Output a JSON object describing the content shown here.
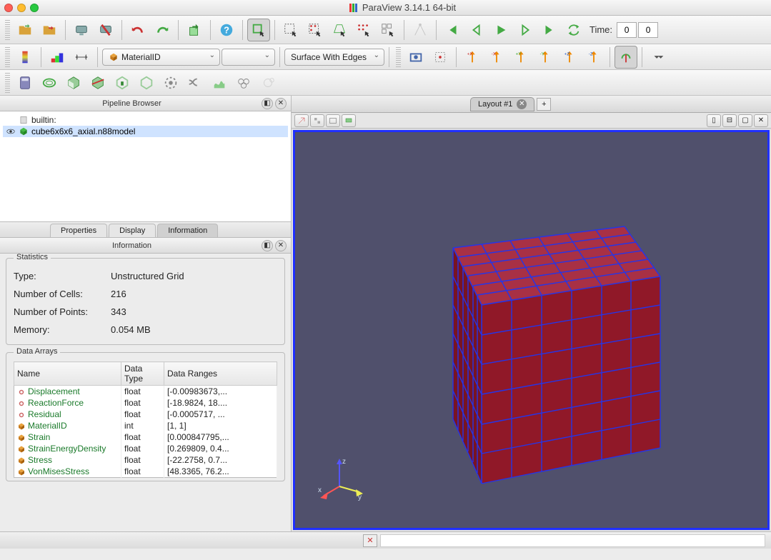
{
  "window": {
    "title": "ParaView 3.14.1 64-bit"
  },
  "toolbar1": {
    "time_label": "Time:",
    "time_val1": "0",
    "time_val2": "0"
  },
  "toolbar2": {
    "combo_color": "MaterialID",
    "combo_mid": "",
    "combo_repr": "Surface With Edges"
  },
  "pipeline": {
    "title": "Pipeline Browser",
    "root": "builtin:",
    "item": "cube6x6x6_axial.n88model"
  },
  "tabs": {
    "props": "Properties",
    "display": "Display",
    "info": "Information"
  },
  "info_panel": {
    "title": "Information"
  },
  "stats": {
    "group": "Statistics",
    "type_k": "Type:",
    "type_v": "Unstructured Grid",
    "cells_k": "Number of Cells:",
    "cells_v": "216",
    "points_k": "Number of Points:",
    "points_v": "343",
    "mem_k": "Memory:",
    "mem_v": "0.054 MB"
  },
  "darrays": {
    "group": "Data Arrays",
    "h_name": "Name",
    "h_type": "Data Type",
    "h_range": "Data Ranges",
    "rows": [
      {
        "kind": "pt",
        "name": "Displacement",
        "type": "float",
        "range": "[-0.00983673,..."
      },
      {
        "kind": "pt",
        "name": "ReactionForce",
        "type": "float",
        "range": "[-18.9824, 18...."
      },
      {
        "kind": "pt",
        "name": "Residual",
        "type": "float",
        "range": "[-0.0005717, ..."
      },
      {
        "kind": "cell",
        "name": "MaterialID",
        "type": "int",
        "range": "[1, 1]"
      },
      {
        "kind": "cell",
        "name": "Strain",
        "type": "float",
        "range": "[0.000847795,..."
      },
      {
        "kind": "cell",
        "name": "StrainEnergyDensity",
        "type": "float",
        "range": "[0.269809, 0.4..."
      },
      {
        "kind": "cell",
        "name": "Stress",
        "type": "float",
        "range": "[-22.2758, 0.7..."
      },
      {
        "kind": "cell",
        "name": "VonMisesStress",
        "type": "float",
        "range": "[48.3365, 76.2..."
      }
    ]
  },
  "layout": {
    "tab": "Layout #1"
  },
  "axes": {
    "x": "x",
    "y": "y",
    "z": "z"
  }
}
